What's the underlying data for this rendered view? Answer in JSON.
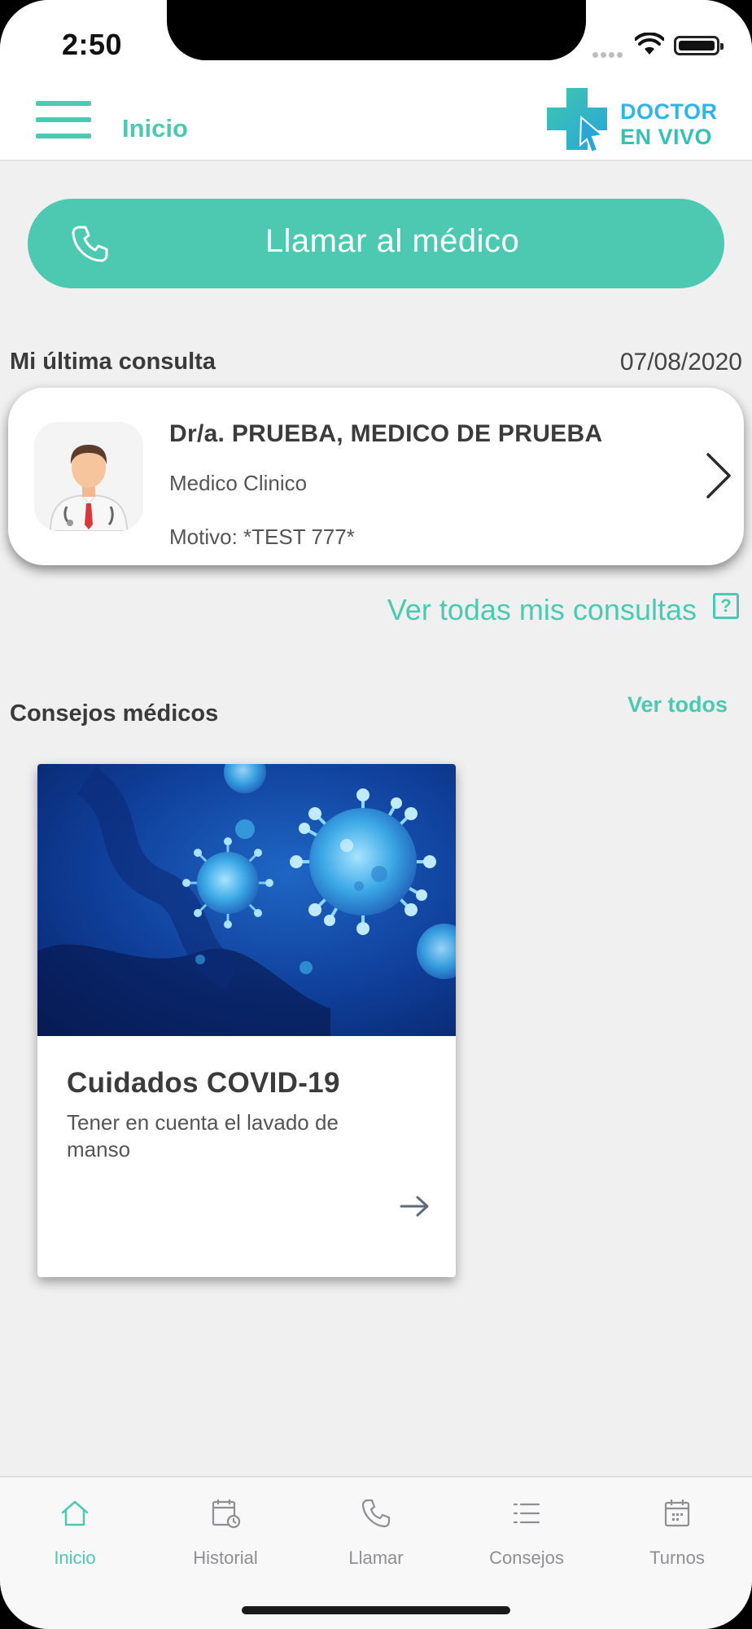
{
  "status_bar": {
    "time": "2:50"
  },
  "header": {
    "title": "Inicio",
    "logo_line1": "DOCTOR",
    "logo_line2": "EN VIVO"
  },
  "call_button": {
    "label": "Llamar al médico",
    "icon": "phone-icon"
  },
  "last_consult": {
    "section_title": "Mi última consulta",
    "date": "07/08/2020",
    "doctor_name": "Dr/a. PRUEBA, MEDICO DE PRUEBA",
    "specialty": "Medico Clinico",
    "reason": "Motivo: *TEST 777*",
    "see_all": "Ver todas mis consultas",
    "help_symbol": "?"
  },
  "tips": {
    "section_title": "Consejos médicos",
    "see_all": "Ver todos",
    "items": [
      {
        "title": "Cuidados COVID-19",
        "description": "Tener en cuenta el lavado de manso"
      }
    ]
  },
  "tab_bar": {
    "active": "Inicio",
    "tabs": [
      {
        "label": "Inicio",
        "icon": "home-icon"
      },
      {
        "label": "Historial",
        "icon": "history-icon"
      },
      {
        "label": "Llamar",
        "icon": "phone-icon"
      },
      {
        "label": "Consejos",
        "icon": "list-icon"
      },
      {
        "label": "Turnos",
        "icon": "calendar-icon"
      }
    ]
  },
  "colors": {
    "accent": "#4cc9b0",
    "logo_blue": "#2bb5e8",
    "background": "#f0f0f0",
    "tab_inactive": "#8e8e93"
  }
}
